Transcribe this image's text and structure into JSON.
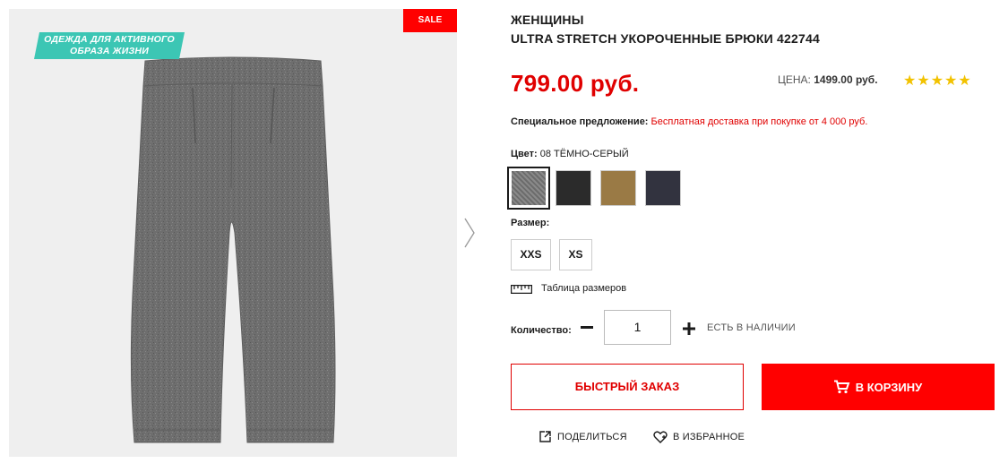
{
  "gallery": {
    "badge_active": "ОДЕЖДА ДЛЯ АКТИВНОГО ОБРАЗА ЖИЗНИ",
    "badge_active_line1": "ОДЕЖДА ДЛЯ АКТИВНОГО",
    "badge_active_line2": "ОБРАЗА ЖИЗНИ",
    "badge_sale": "SALE",
    "next_icon": "chevron-right-icon"
  },
  "product": {
    "category": "ЖЕНЩИНЫ",
    "title": "ULTRA STRETCH УКОРОЧЕННЫЕ БРЮКИ 422744",
    "price": "799.00 руб.",
    "old_price_label": "ЦЕНА:",
    "old_price_value": "1499.00 руб.",
    "rating_stars": "★★★★★",
    "rating": 5
  },
  "offer": {
    "label": "Специальное предложение:",
    "text": "Бесплатная доставка при покупке от 4 000 руб."
  },
  "color": {
    "label": "Цвет:",
    "selected": "08 ТЁМНО-СЕРЫЙ",
    "swatches": [
      {
        "name": "dark-gray",
        "hex": "#7d7d7d"
      },
      {
        "name": "black",
        "hex": "#2b2b2b"
      },
      {
        "name": "brown",
        "hex": "#9a7a45"
      },
      {
        "name": "navy",
        "hex": "#32333f"
      }
    ]
  },
  "size": {
    "label": "Размер:",
    "options": [
      "XXS",
      "XS"
    ],
    "chart_label": "Таблица размеров"
  },
  "quantity": {
    "label": "Количество:",
    "value": "1",
    "stock": "ЕСТЬ В НАЛИЧИИ"
  },
  "actions": {
    "quick_order": "БЫСТРЫЙ ЗАКАЗ",
    "add_to_cart": "В КОРЗИНУ",
    "share": "ПОДЕЛИТЬСЯ",
    "wishlist": "В ИЗБРАННОЕ"
  },
  "colors": {
    "accent_red": "#ff0000",
    "price_red": "#e00000",
    "star_yellow": "#f2c200",
    "badge_teal": "#3cc6b4"
  }
}
